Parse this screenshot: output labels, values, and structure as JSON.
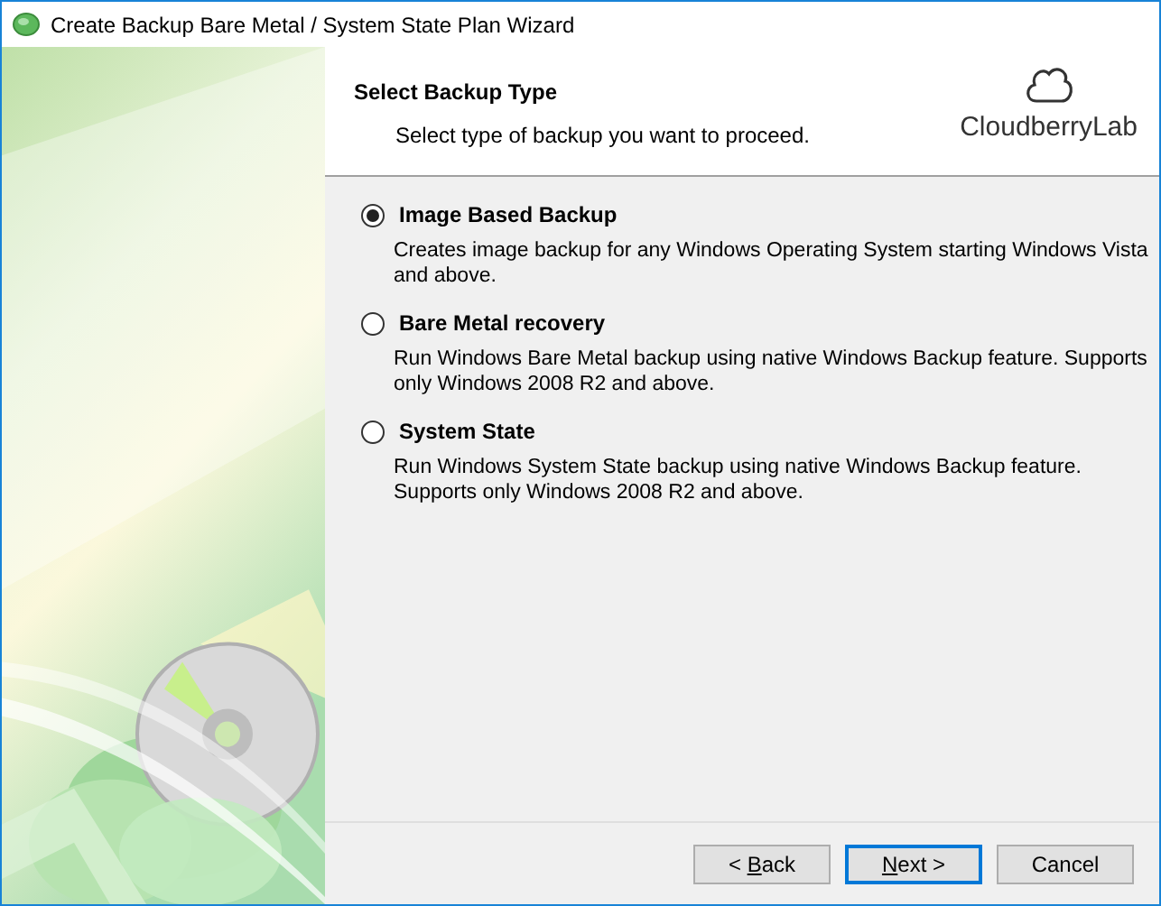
{
  "window": {
    "title": "Create Backup Bare Metal / System State Plan Wizard"
  },
  "header": {
    "title": "Select Backup Type",
    "subtitle": "Select type of backup you want to proceed.",
    "logo_text": "CloudberryLab"
  },
  "options": [
    {
      "label": "Image Based Backup",
      "description": "Creates image backup for any Windows Operating System starting Windows Vista and above.",
      "selected": true
    },
    {
      "label": "Bare Metal recovery",
      "description": "Run Windows Bare Metal backup using native Windows Backup feature. Supports only Windows 2008 R2 and above.",
      "selected": false
    },
    {
      "label": "System State",
      "description": "Run Windows System State backup using native Windows Backup feature. Supports only Windows 2008 R2 and above.",
      "selected": false
    }
  ],
  "buttons": [
    {
      "pre": "< ",
      "access_key": "B",
      "post": "ack",
      "default": false
    },
    {
      "access_key": "N",
      "post": "ext >",
      "default": true
    },
    {
      "pre": "Cancel",
      "default": false
    }
  ]
}
